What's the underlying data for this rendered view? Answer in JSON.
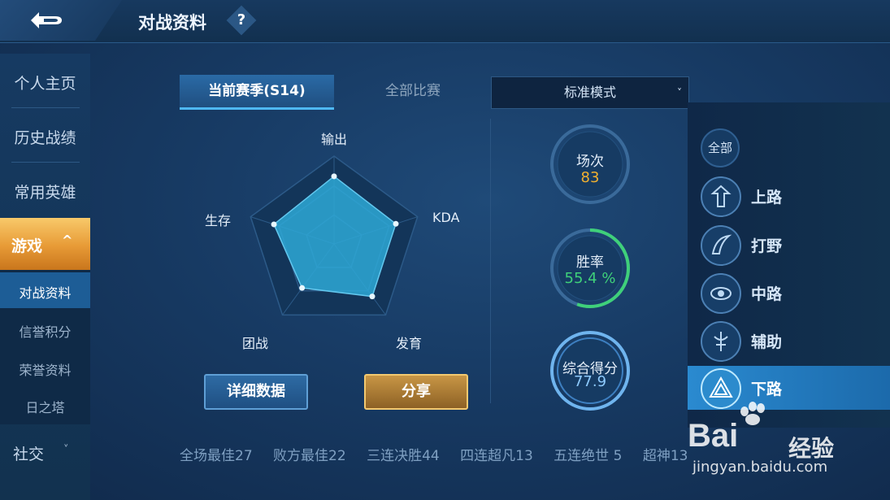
{
  "header": {
    "title": "对战资料",
    "help_label": "?"
  },
  "sidebar": {
    "items": [
      {
        "label": "个人主页"
      },
      {
        "label": "历史战绩"
      },
      {
        "label": "常用英雄"
      }
    ],
    "active": {
      "label": "游戏",
      "chevron": "^"
    },
    "subitems": [
      {
        "label": "对战资料",
        "active": true
      },
      {
        "label": "信誉积分"
      },
      {
        "label": "荣誉资料"
      },
      {
        "label": "日之塔"
      }
    ],
    "social": {
      "label": "社交",
      "chevron": "˅"
    }
  },
  "tabs": [
    {
      "label": "当前赛季(S14)",
      "active": true
    },
    {
      "label": "全部比赛"
    }
  ],
  "mode_select": {
    "value": "标准模式",
    "chevron": "˅"
  },
  "radar": {
    "labels": {
      "output": "输出",
      "kda": "KDA",
      "growth": "发育",
      "team": "团战",
      "survive": "生存"
    },
    "values": {
      "output": 0.77,
      "kda": 0.74,
      "growth": 0.74,
      "team": 0.62,
      "survive": 0.72
    }
  },
  "buttons": {
    "detail": "详细数据",
    "share": "分享"
  },
  "stats": {
    "matches": {
      "label": "场次",
      "value": "83"
    },
    "winrate": {
      "label": "胜率",
      "value": "55.4 %",
      "progress": 0.554
    },
    "score": {
      "label": "综合得分",
      "value": "77.9"
    }
  },
  "bottom_stats": [
    "全场最佳27",
    "败方最佳22",
    "三连决胜44",
    "四连超凡13",
    "五连绝世 5",
    "超神13"
  ],
  "lanes": {
    "all_label": "全部",
    "items": [
      {
        "label": "上路",
        "icon": "top-lane-icon"
      },
      {
        "label": "打野",
        "icon": "jungle-icon"
      },
      {
        "label": "中路",
        "icon": "mid-lane-icon"
      },
      {
        "label": "辅助",
        "icon": "support-icon"
      },
      {
        "label": "下路",
        "icon": "bottom-lane-icon",
        "active": true
      }
    ]
  },
  "watermark": {
    "brand": "Bai",
    "brand_suffix": "经验",
    "url": "jingyan.baidu.com"
  },
  "colors": {
    "accent_blue": "#4fb8f5",
    "gold": "#f0b030",
    "green": "#3fd07a",
    "radar_fill": "#2ea8d6"
  }
}
